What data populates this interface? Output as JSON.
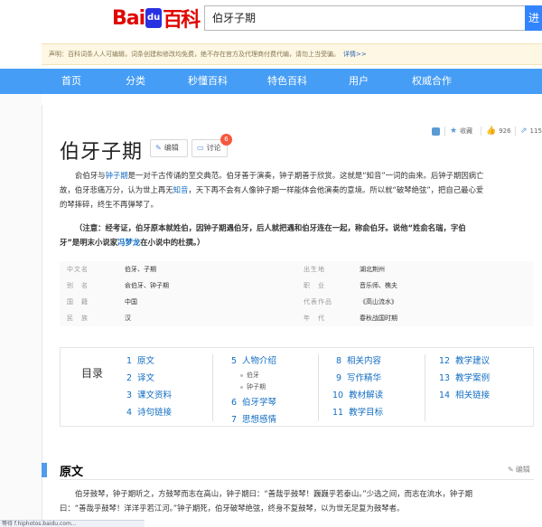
{
  "logo": {
    "part1": "Bai",
    "paw": "du",
    "part2": "百科"
  },
  "search": {
    "value": "伯牙子期",
    "button": "进"
  },
  "notice": {
    "text": "声明：百科词条人人可编辑，词条创建和修改均免费，绝不存在官方及代理商付费代编，请勿上当受骗。",
    "more": "详情>>"
  },
  "nav": [
    "首页",
    "分类",
    "秒懂百科",
    "特色百科",
    "用户",
    "权威合作"
  ],
  "entry": {
    "title": "伯牙子期",
    "edit_label": "编辑",
    "discuss_label": "讨论",
    "discuss_count": "6"
  },
  "tools": {
    "collect": "收藏",
    "likes": "926",
    "share_count": "115"
  },
  "summary": {
    "line1_a": "俞伯牙与",
    "line1_link": "钟子期",
    "line1_b": "是一对千古传诵的至交典范。伯牙善于演奏，钟子期善于欣赏。这就是“知音”一词的由来。后钟子期因病亡",
    "line2_a": "故，伯牙悲痛万分，认为世上再无",
    "line2_link": "知音",
    "line2_b": "，天下再不会有人像钟子期一样能体会他演奏的意境。所以就“破琴绝弦”，把自己最心爱",
    "line3": "的琴摔碎，终生不再弹琴了。"
  },
  "note": {
    "line1": "（注意：经考证，伯牙原本就姓伯，因钟子期遇伯牙，后人就把遇和伯牙连在一起，称俞伯牙。说他“姓俞名瑞，字伯",
    "line2_a": "牙”是明末小说家",
    "line2_link": "冯梦龙",
    "line2_b": "在小说中的杜撰。）"
  },
  "basic_info": {
    "left": [
      {
        "label": "中文名",
        "value": "伯牙、子期"
      },
      {
        "label": "别　名",
        "value": "俞伯牙、钟子期"
      },
      {
        "label": "国　籍",
        "value": "中国"
      },
      {
        "label": "民　族",
        "value": "汉"
      }
    ],
    "right": [
      {
        "label": "出生地",
        "value": "湖北荆州"
      },
      {
        "label": "职　业",
        "value": "音乐师、樵夫"
      },
      {
        "label": "代表作品",
        "value": "《高山流水》"
      },
      {
        "label": "年　代",
        "value": "春秋战国时期"
      }
    ]
  },
  "toc": {
    "title": "目录",
    "col1": [
      {
        "num": "1",
        "label": "原文"
      },
      {
        "num": "2",
        "label": "译文"
      },
      {
        "num": "3",
        "label": "课文资料"
      },
      {
        "num": "4",
        "label": "诗句链接"
      }
    ],
    "col2": [
      {
        "num": "5",
        "label": "人物介绍"
      },
      {
        "num": "6",
        "label": "伯牙学琴"
      },
      {
        "num": "7",
        "label": "思想感情"
      }
    ],
    "col2_sub": [
      "伯牙",
      "钟子期"
    ],
    "col3": [
      {
        "num": "8",
        "label": "相关内容"
      },
      {
        "num": "9",
        "label": "写作精华"
      },
      {
        "num": "10",
        "label": "教材解读"
      },
      {
        "num": "11",
        "label": "教学目标"
      }
    ],
    "col4": [
      {
        "num": "12",
        "label": "教学建议"
      },
      {
        "num": "13",
        "label": "教学案例"
      },
      {
        "num": "14",
        "label": "相关链接"
      }
    ]
  },
  "section": {
    "title": "原文",
    "edit_label": "编辑",
    "line1": "伯牙鼓琴，钟子期听之，方鼓琴而志在高山，钟子期曰：“善哉乎鼓琴！巍巍乎若泰山。”少选之间，而志在流水，钟子期",
    "line2": "曰：“善哉乎鼓琴！洋洋乎若江河。”钟子期死，伯牙破琴绝弦，终身不复鼓琴，以为世无足复为鼓琴者。"
  },
  "status_url": "等待 f.hiphotos.baidu.com…"
}
